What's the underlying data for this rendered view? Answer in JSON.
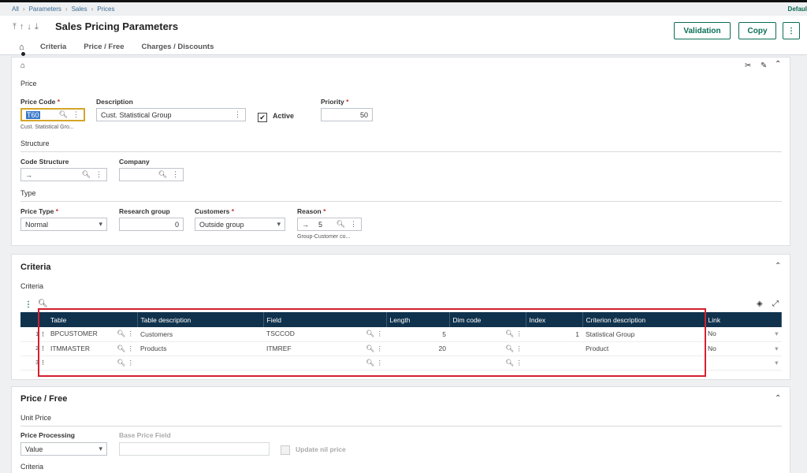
{
  "breadcrumb": [
    "All",
    "Parameters",
    "Sales",
    "Prices"
  ],
  "user": "Defaul",
  "header": {
    "title": "Sales Pricing Parameters",
    "buttons": {
      "validation": "Validation",
      "copy": "Copy",
      "more": "⋮"
    },
    "tabs": [
      "Criteria",
      "Price / Free",
      "Charges / Discounts"
    ]
  },
  "main": {
    "section_price": "Price",
    "price_code": {
      "label": "Price Code",
      "value": "T60",
      "sub": "Cust. Statistical Gro..."
    },
    "description": {
      "label": "Description",
      "value": "Cust. Statistical Group"
    },
    "active": {
      "label": "Active",
      "checked": true
    },
    "priority": {
      "label": "Priority",
      "value": "50"
    },
    "section_structure": "Structure",
    "code_structure": {
      "label": "Code Structure",
      "value": "→"
    },
    "company": {
      "label": "Company",
      "value": ""
    },
    "section_type": "Type",
    "price_type": {
      "label": "Price Type",
      "value": "Normal"
    },
    "research_group": {
      "label": "Research group",
      "value": "0"
    },
    "customers": {
      "label": "Customers",
      "value": "Outside group"
    },
    "reason": {
      "label": "Reason",
      "arrow": "→",
      "value": "5",
      "sub": "Group-Customer co..."
    }
  },
  "criteria": {
    "title": "Criteria",
    "subtitle": "Criteria",
    "columns": [
      "Table",
      "Table description",
      "Field",
      "Length",
      "Dim code",
      "Index",
      "Criterion description",
      "Link"
    ],
    "rows": [
      {
        "n": "1",
        "table": "BPCUSTOMER",
        "desc": "Customers",
        "field": "TSCCOD",
        "length": "5",
        "dim": "",
        "index": "1",
        "crit": "Statistical Group",
        "link": "No"
      },
      {
        "n": "2",
        "table": "ITMMASTER",
        "desc": "Products",
        "field": "ITMREF",
        "length": "20",
        "dim": "",
        "index": "",
        "crit": "Product",
        "link": "No"
      },
      {
        "n": "3",
        "table": "",
        "desc": "",
        "field": "",
        "length": "",
        "dim": "",
        "index": "",
        "crit": "",
        "link": ""
      }
    ]
  },
  "price_free": {
    "title": "Price / Free",
    "unit_price": "Unit Price",
    "price_processing": {
      "label": "Price Processing",
      "value": "Value"
    },
    "base_price_field": {
      "label": "Base Price Field",
      "value": ""
    },
    "update_nil": "Update nil price",
    "criteria": "Criteria"
  }
}
